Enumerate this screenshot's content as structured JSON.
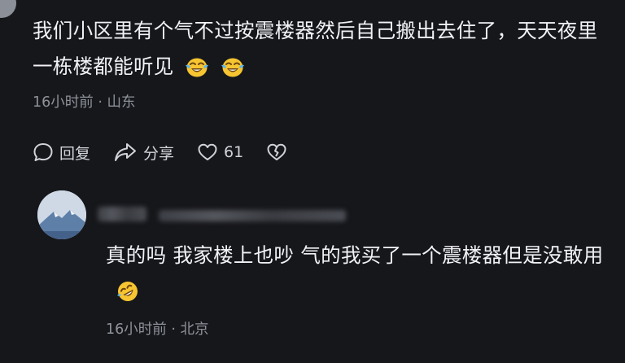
{
  "comment": {
    "text": "我们小区里有个气不过按震楼器然后自己搬出去住了，天天夜里一栋楼都能听见",
    "time": "16小时前",
    "location": "山东",
    "emojis": [
      "laugh-cry-emoji",
      "laugh-cry-emoji"
    ]
  },
  "actions": {
    "reply_label": "回复",
    "share_label": "分享",
    "like_count": "61",
    "icons": [
      "comment-bubble-icon",
      "share-arrow-icon",
      "heart-icon",
      "broken-heart-icon"
    ]
  },
  "reply": {
    "text": "真的吗 我家楼上也吵 气的我买了一个震楼器但是没敢用",
    "time": "16小时前",
    "location": "北京",
    "emojis": [
      "rofl-emoji"
    ]
  },
  "colors": {
    "background": "#16171b",
    "text": "#f1f2f5",
    "meta": "#8e929a",
    "emoji_yellow": "#f6c531"
  }
}
